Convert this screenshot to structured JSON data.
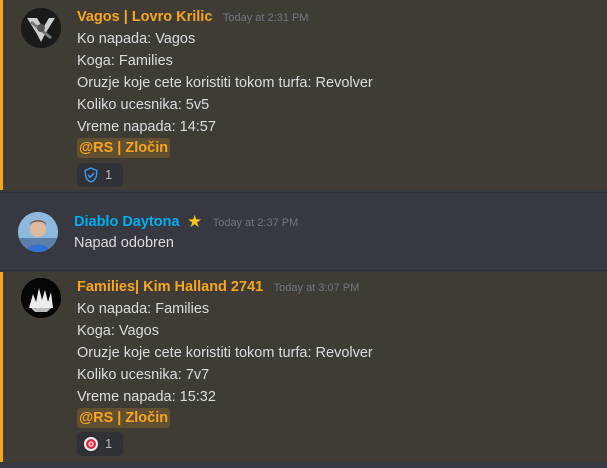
{
  "messages": [
    {
      "author": "Vagos | Lovro Krilic",
      "author_color": "#faa61a",
      "timestamp": "Today at 2:31 PM",
      "lines": [
        "Ko napada: Vagos",
        "Koga: Families",
        "Oruzje koje cete koristiti tokom turfa: Revolver",
        "Koliko ucesnika: 5v5",
        "Vreme napada: 14:57"
      ],
      "mention": "@RS | Zločin",
      "reaction": {
        "icon": "shield-check-icon",
        "count": "1"
      }
    },
    {
      "author": "Diablo Daytona",
      "author_color": "#00aff4",
      "badge_icon": "star-icon",
      "timestamp": "Today at 2:37 PM",
      "lines": [
        "Napad odobren"
      ]
    },
    {
      "author": "Families| Kim Halland 2741",
      "author_color": "#faa61a",
      "timestamp": "Today at 3:07 PM",
      "lines": [
        "Ko napada: Families",
        "Koga: Vagos",
        "Oruzje koje cete koristiti tokom turfa: Revolver",
        "Koliko ucesnika: 7v7",
        "Vreme napada: 15:32"
      ],
      "mention": "@RS | Zločin",
      "reaction": {
        "icon": "target-icon",
        "count": "1"
      }
    }
  ],
  "colors": {
    "mention_highlight": "#faa61a",
    "background": "#36393f",
    "mention_background": "#3f3c36"
  }
}
